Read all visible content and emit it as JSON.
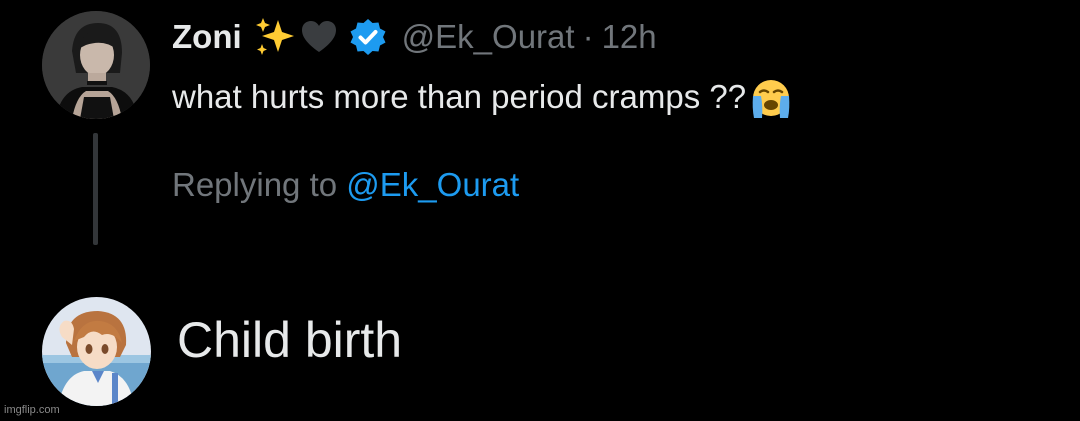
{
  "tweet": {
    "author_name": "Zoni",
    "name_emojis": [
      "sparkles-emoji",
      "black-heart-emoji"
    ],
    "verified": true,
    "handle": "@Ek_Ourat",
    "separator": "·",
    "time": "12h",
    "text": "what hurts more than period cramps ??",
    "text_emoji": "loudly-crying-face-emoji",
    "avatar": "woman-portrait-avatar"
  },
  "reply": {
    "replying_prefix": "Replying to",
    "replying_handle": "@Ek_Ourat",
    "text": "Child birth",
    "avatar": "anime-boy-avatar"
  },
  "watermark": "imgflip.com",
  "colors": {
    "background": "#000000",
    "primary_text": "#e7e9ea",
    "secondary_text": "#71767b",
    "accent": "#1d9bf0",
    "thread_line": "#333639"
  }
}
